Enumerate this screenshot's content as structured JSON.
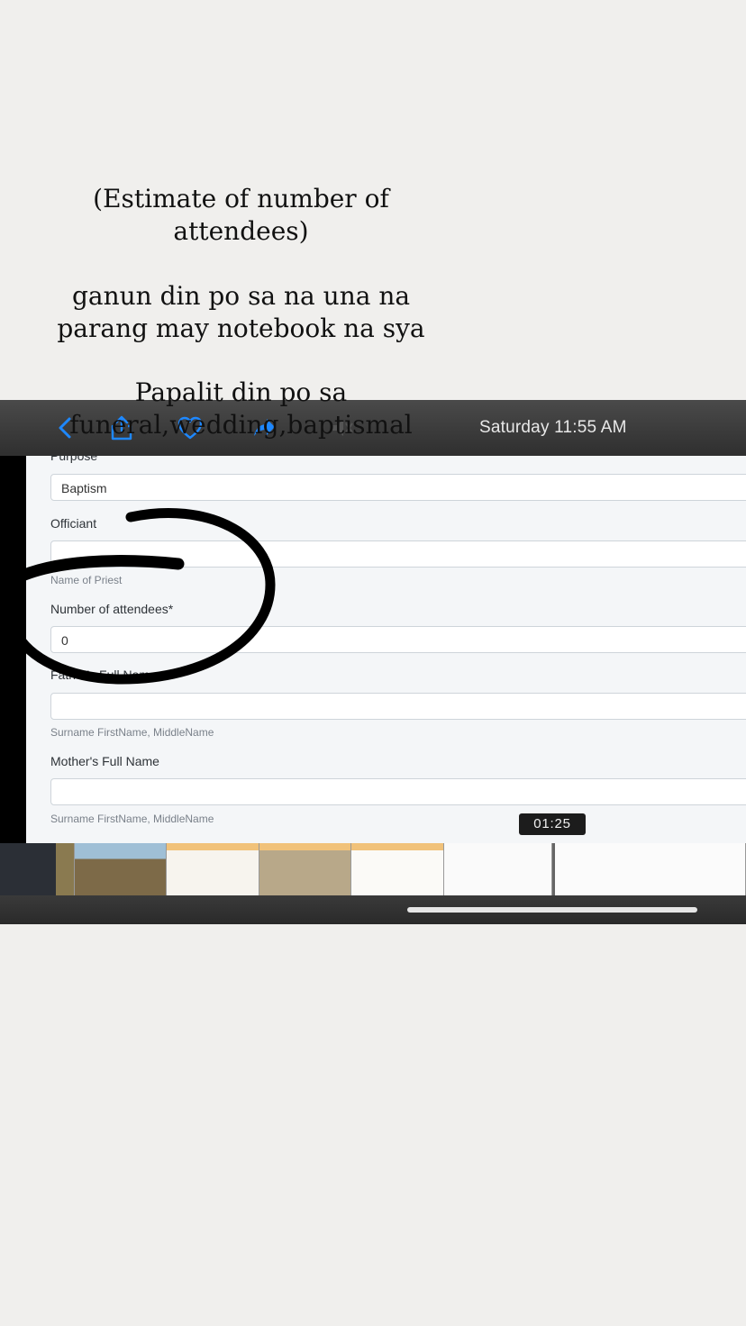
{
  "captions": {
    "line1": "(Estimate of number of attendees)",
    "line2": "ganun din po sa na una na parang may notebook na sya",
    "line3": "Papalit din po sa funeral,wedding,baptismal"
  },
  "status_bar": {
    "time": "Saturday  11:55 AM"
  },
  "toolbar_icons": [
    "back-chevron-icon",
    "share-icon",
    "favorite-heart-icon",
    "forward-icon",
    "mute-icon"
  ],
  "form": {
    "purpose": {
      "label": "Purpose",
      "value": "Baptism"
    },
    "officiant": {
      "label": "Officiant",
      "value": "",
      "hint": "Name of Priest"
    },
    "attendees": {
      "label": "Number of attendees*",
      "value": "0"
    },
    "father": {
      "label": "Father's Full Name",
      "value": "",
      "hint": "Surname FirstName, MiddleName"
    },
    "mother": {
      "label": "Mother's Full Name",
      "value": "",
      "hint": "Surname FirstName, MiddleName"
    }
  },
  "video": {
    "timestamp": "01:25"
  },
  "colors": {
    "accent": "#1e88ff",
    "annotation": "#000000",
    "form_bg": "#f4f6f8"
  }
}
